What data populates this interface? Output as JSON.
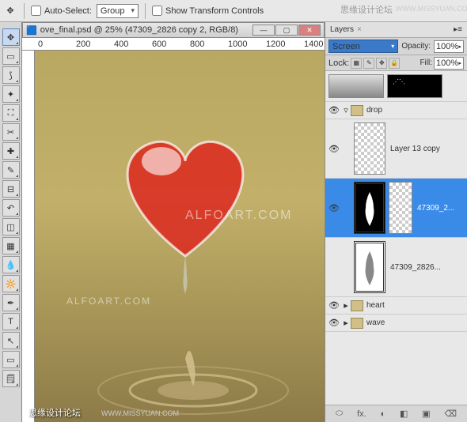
{
  "toolbar": {
    "auto_select_label": "Auto-Select:",
    "group_value": "Group",
    "show_transform_label": "Show Transform Controls"
  },
  "watermarks": {
    "top_cn": "思缘设计论坛",
    "top_url": "WWW.MISSYUAN.COM",
    "img_brand": "ALFOART.COM",
    "img_brand2": "ALFOART.COM",
    "bottom_cn": "思缘设计论坛",
    "bottom_url": "WWW.MISSYUAN.COM"
  },
  "document": {
    "title": "ove_final.psd @ 25% (47309_2826 copy 2, RGB/8)",
    "ruler_marks": [
      "0",
      "200",
      "400",
      "600",
      "800",
      "1000",
      "1200",
      "1400"
    ]
  },
  "layers": {
    "tab_label": "Layers",
    "blend_mode": "Screen",
    "opacity_label": "Opacity:",
    "opacity_value": "100%",
    "lock_label": "Lock:",
    "fill_label": "Fill:",
    "fill_value": "100%",
    "items": [
      {
        "type": "thumbs"
      },
      {
        "type": "group",
        "name": "drop",
        "expanded": true
      },
      {
        "type": "layer",
        "name": "Layer 13 copy",
        "thumb": "checker"
      },
      {
        "type": "smart",
        "name": "47309_2...",
        "thumb": "black-vase",
        "selected": true
      },
      {
        "type": "smart",
        "name": "47309_2826...",
        "thumb": "gray-vase"
      },
      {
        "type": "group",
        "name": "heart",
        "expanded": false
      },
      {
        "type": "group",
        "name": "wave",
        "expanded": false
      }
    ],
    "footer_icons": [
      "⬭",
      "fx.",
      "◐",
      "◧",
      "▣",
      "⌫"
    ]
  }
}
